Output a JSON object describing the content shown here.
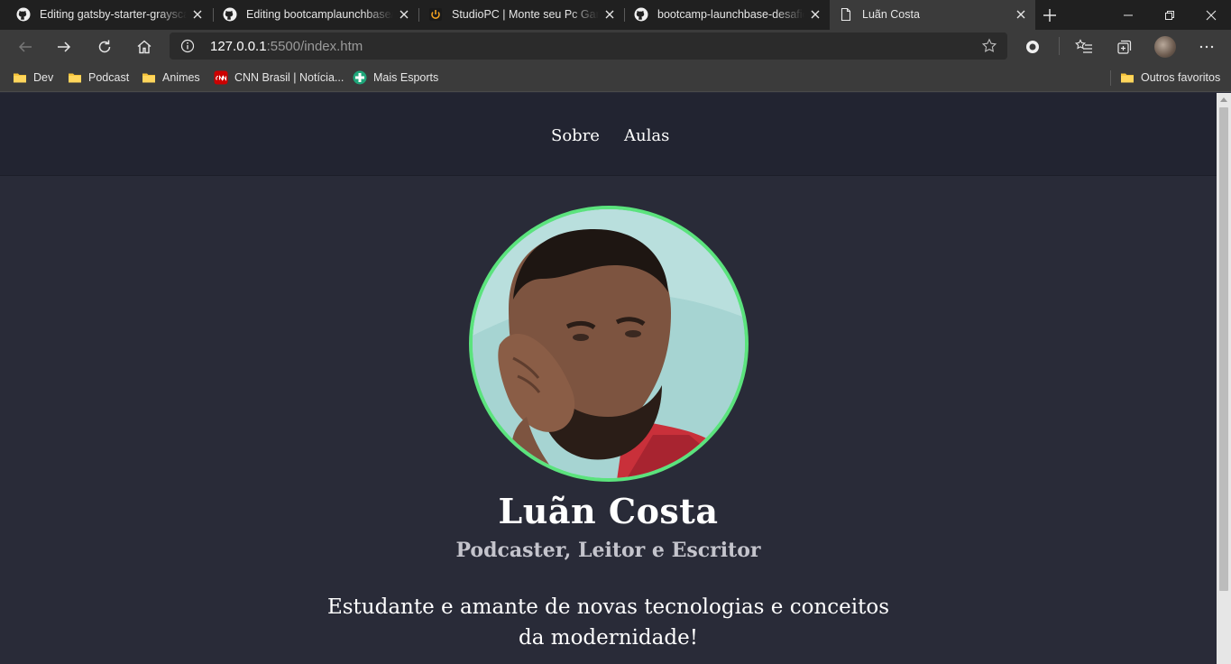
{
  "browser": {
    "tabs": [
      {
        "title": "Editing gatsby-starter-grayscal",
        "icon": "github-icon"
      },
      {
        "title": "Editing bootcamplaunchbase/",
        "icon": "github-icon"
      },
      {
        "title": "StudioPC | Monte seu Pc Game",
        "icon": "power-icon"
      },
      {
        "title": "bootcamp-launchbase-desafio",
        "icon": "github-icon"
      },
      {
        "title": "Luãn Costa",
        "icon": "page-icon",
        "active": true
      }
    ],
    "address": {
      "host": "127.0.0.1",
      "path": ":5500/index.htm"
    },
    "bookmarks": [
      {
        "label": "Dev",
        "icon": "folder-icon"
      },
      {
        "label": "Podcast",
        "icon": "folder-icon"
      },
      {
        "label": "Animes",
        "icon": "folder-icon"
      },
      {
        "label": "CNN Brasil | Notícia...",
        "icon": "cnn-icon"
      },
      {
        "label": "Mais Esports",
        "icon": "plus-cross-icon"
      }
    ],
    "other_favorites": "Outros favoritos"
  },
  "site": {
    "nav": [
      "Sobre",
      "Aulas"
    ],
    "profile": {
      "name": "Luãn Costa",
      "role": "Podcaster, Leitor e Escritor",
      "bio": "Estudante e amante de novas tecnologias e conceitos da modernidade!"
    }
  },
  "colors": {
    "page_bg": "#292b38",
    "header_bg": "#222431",
    "avatar_border": "#5be37d",
    "text": "#ffffff",
    "muted_text": "#c4c4cc"
  }
}
